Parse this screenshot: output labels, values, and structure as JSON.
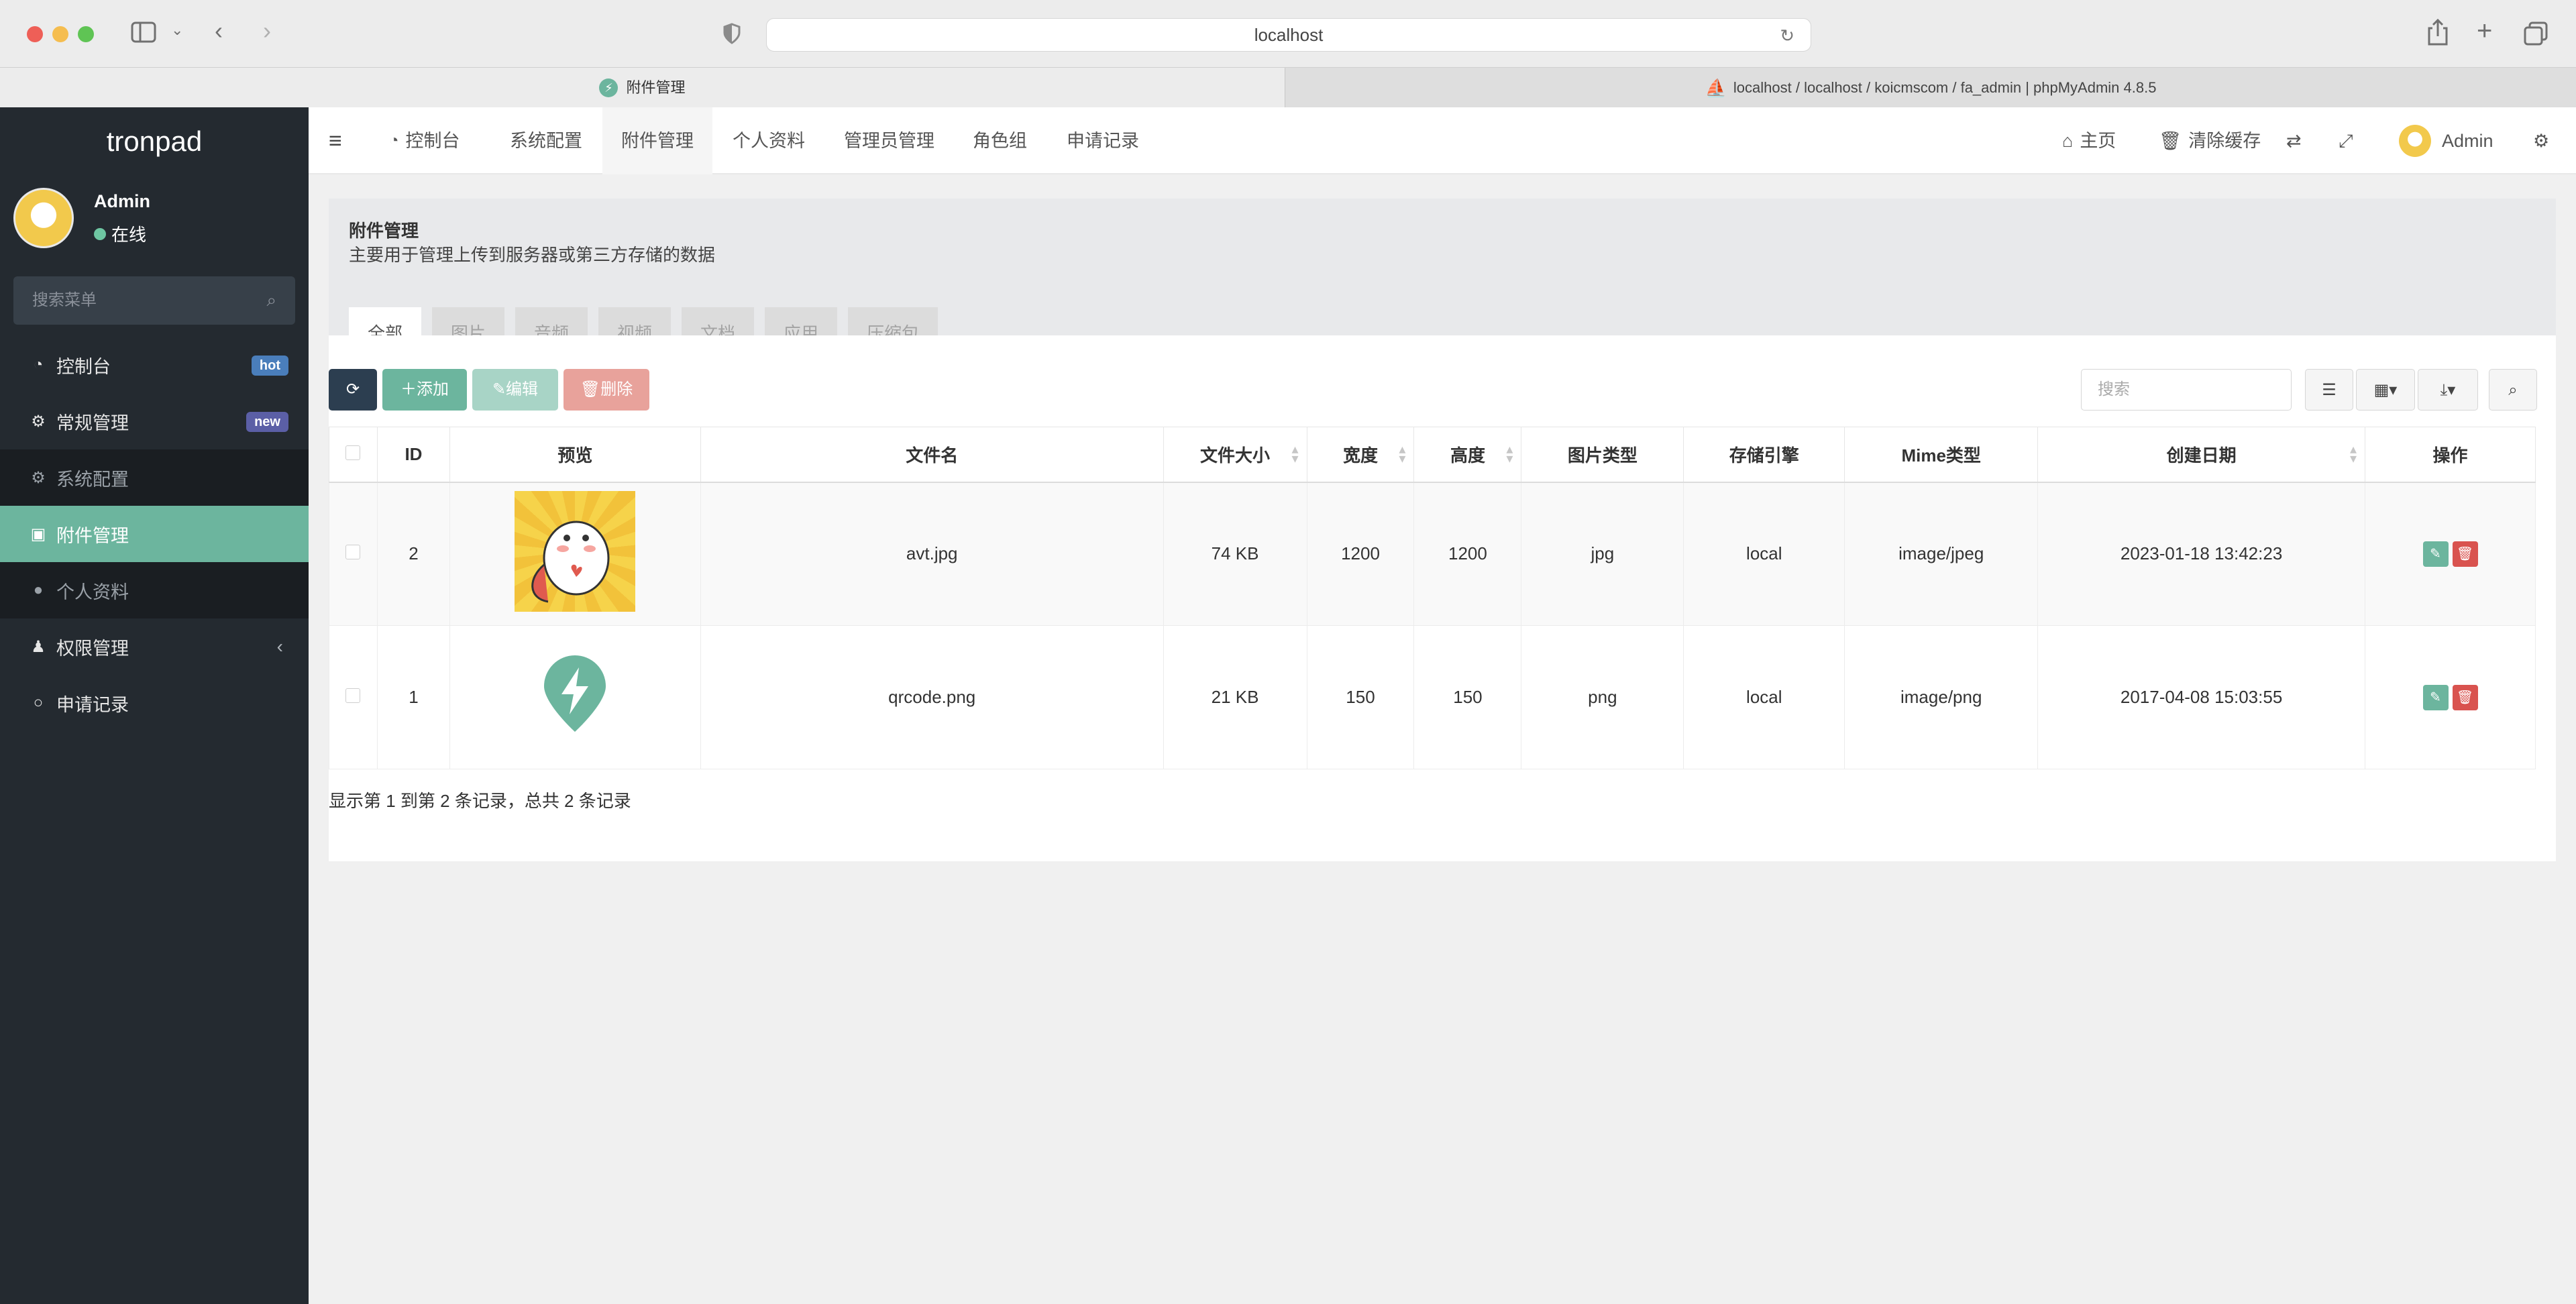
{
  "browser": {
    "url": "localhost",
    "tabs": [
      {
        "label": "附件管理"
      },
      {
        "label": "localhost / localhost / koicmscom / fa_admin | phpMyAdmin 4.8.5"
      }
    ]
  },
  "sidebar": {
    "brand": "tronpad",
    "user": {
      "name": "Admin",
      "status": "在线"
    },
    "search_placeholder": "搜索菜单",
    "items": [
      {
        "label": "控制台",
        "badge": "hot"
      },
      {
        "label": "常规管理",
        "badge": "new"
      },
      {
        "label": "系统配置"
      },
      {
        "label": "附件管理"
      },
      {
        "label": "个人资料"
      },
      {
        "label": "权限管理"
      },
      {
        "label": "申请记录"
      }
    ]
  },
  "topnav": {
    "tabs": [
      "控制台",
      "系统配置",
      "附件管理",
      "个人资料",
      "管理员管理",
      "角色组",
      "申请记录"
    ],
    "right": {
      "home": "主页",
      "clear_cache": "清除缓存",
      "user": "Admin"
    }
  },
  "panel": {
    "title": "附件管理",
    "subtitle": "主要用于管理上传到服务器或第三方存储的数据",
    "tabs": [
      "全部",
      "图片",
      "音频",
      "视频",
      "文档",
      "应用",
      "压缩包"
    ]
  },
  "toolbar": {
    "add": "添加",
    "edit": "编辑",
    "delete": "删除",
    "search_placeholder": "搜索"
  },
  "table": {
    "headers": [
      "ID",
      "预览",
      "文件名",
      "文件大小",
      "宽度",
      "高度",
      "图片类型",
      "存储引擎",
      "Mime类型",
      "创建日期",
      "操作"
    ],
    "rows": [
      {
        "id": "2",
        "filename": "avt.jpg",
        "size": "74 KB",
        "width": "1200",
        "height": "1200",
        "type": "jpg",
        "storage": "local",
        "mime": "image/jpeg",
        "created": "2023-01-18 13:42:23"
      },
      {
        "id": "1",
        "filename": "qrcode.png",
        "size": "21 KB",
        "width": "150",
        "height": "150",
        "type": "png",
        "storage": "local",
        "mime": "image/png",
        "created": "2017-04-08 15:03:55"
      }
    ],
    "info": "显示第 1 到第 2 条记录，总共 2 条记录"
  },
  "colors": {
    "accent": "#6cb59e",
    "sidebar_bg": "#242a30",
    "hot": "#4a7ebb",
    "new": "#5b5fa6",
    "danger": "#d9534f",
    "dark_button": "#2c3e50"
  }
}
